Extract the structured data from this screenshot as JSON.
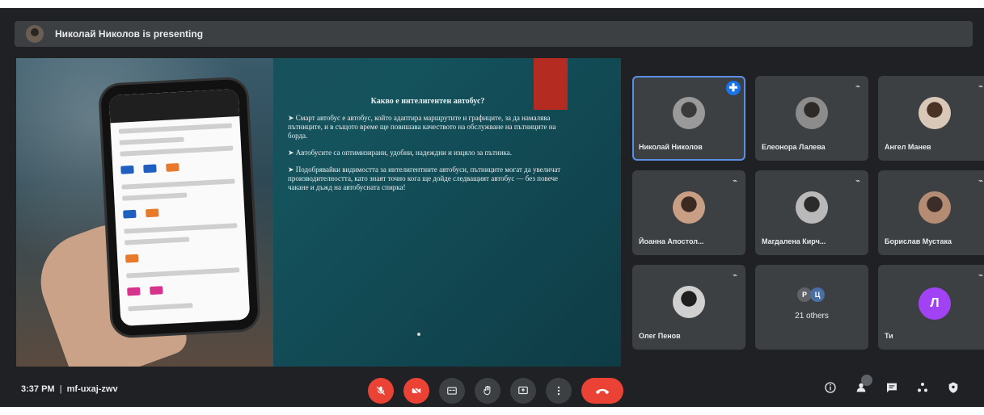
{
  "header": {
    "presenting_text": "Николай Николов is presenting"
  },
  "slide": {
    "heading": "Какво е интелигентен автобус?",
    "bullets": [
      "➤ Смарт автобус е автобус, който адаптира маршрутите и графиците, за да намалява пътниците, и в същото време ще повишава качеството на обслужване на пътниците на борда.",
      "➤ Автобусите са оптимизирани, удобни, надеждни и изцяло за пътника.",
      "➤ Подобрявайки видимостта за интелигентните автобуси, пътниците могат да увеличат производителността, като знаят точно кога ще дойде следващият автобус — без повече чакане и дъжд на автобусната спирка!"
    ]
  },
  "participants": [
    {
      "name": "Николай Николов",
      "mic": "muted",
      "pinned": true
    },
    {
      "name": "Елеонора Лалева",
      "mic": "muted"
    },
    {
      "name": "Ангел Манев",
      "mic": "muted"
    },
    {
      "name": "Йоанна Апостол...",
      "mic": "muted"
    },
    {
      "name": "Магдалена Кирч...",
      "mic": "muted"
    },
    {
      "name": "Борислав Мустака",
      "mic": "muted"
    },
    {
      "name": "Олег Пенов",
      "mic": "muted"
    },
    {
      "others_label": "21 others",
      "avatars": [
        "Р",
        "Ц"
      ]
    },
    {
      "name": "Ти",
      "avatar_letter": "Л",
      "mic": "muted",
      "avatar_color": "#a142f4"
    }
  ],
  "bottombar": {
    "time": "3:37 PM",
    "separator": "|",
    "meeting_code": "mf-uxaj-zwv"
  },
  "colors": {
    "end_call": "#ea4335",
    "pin": "#1a73e8",
    "active_border": "#5b8fe6"
  }
}
